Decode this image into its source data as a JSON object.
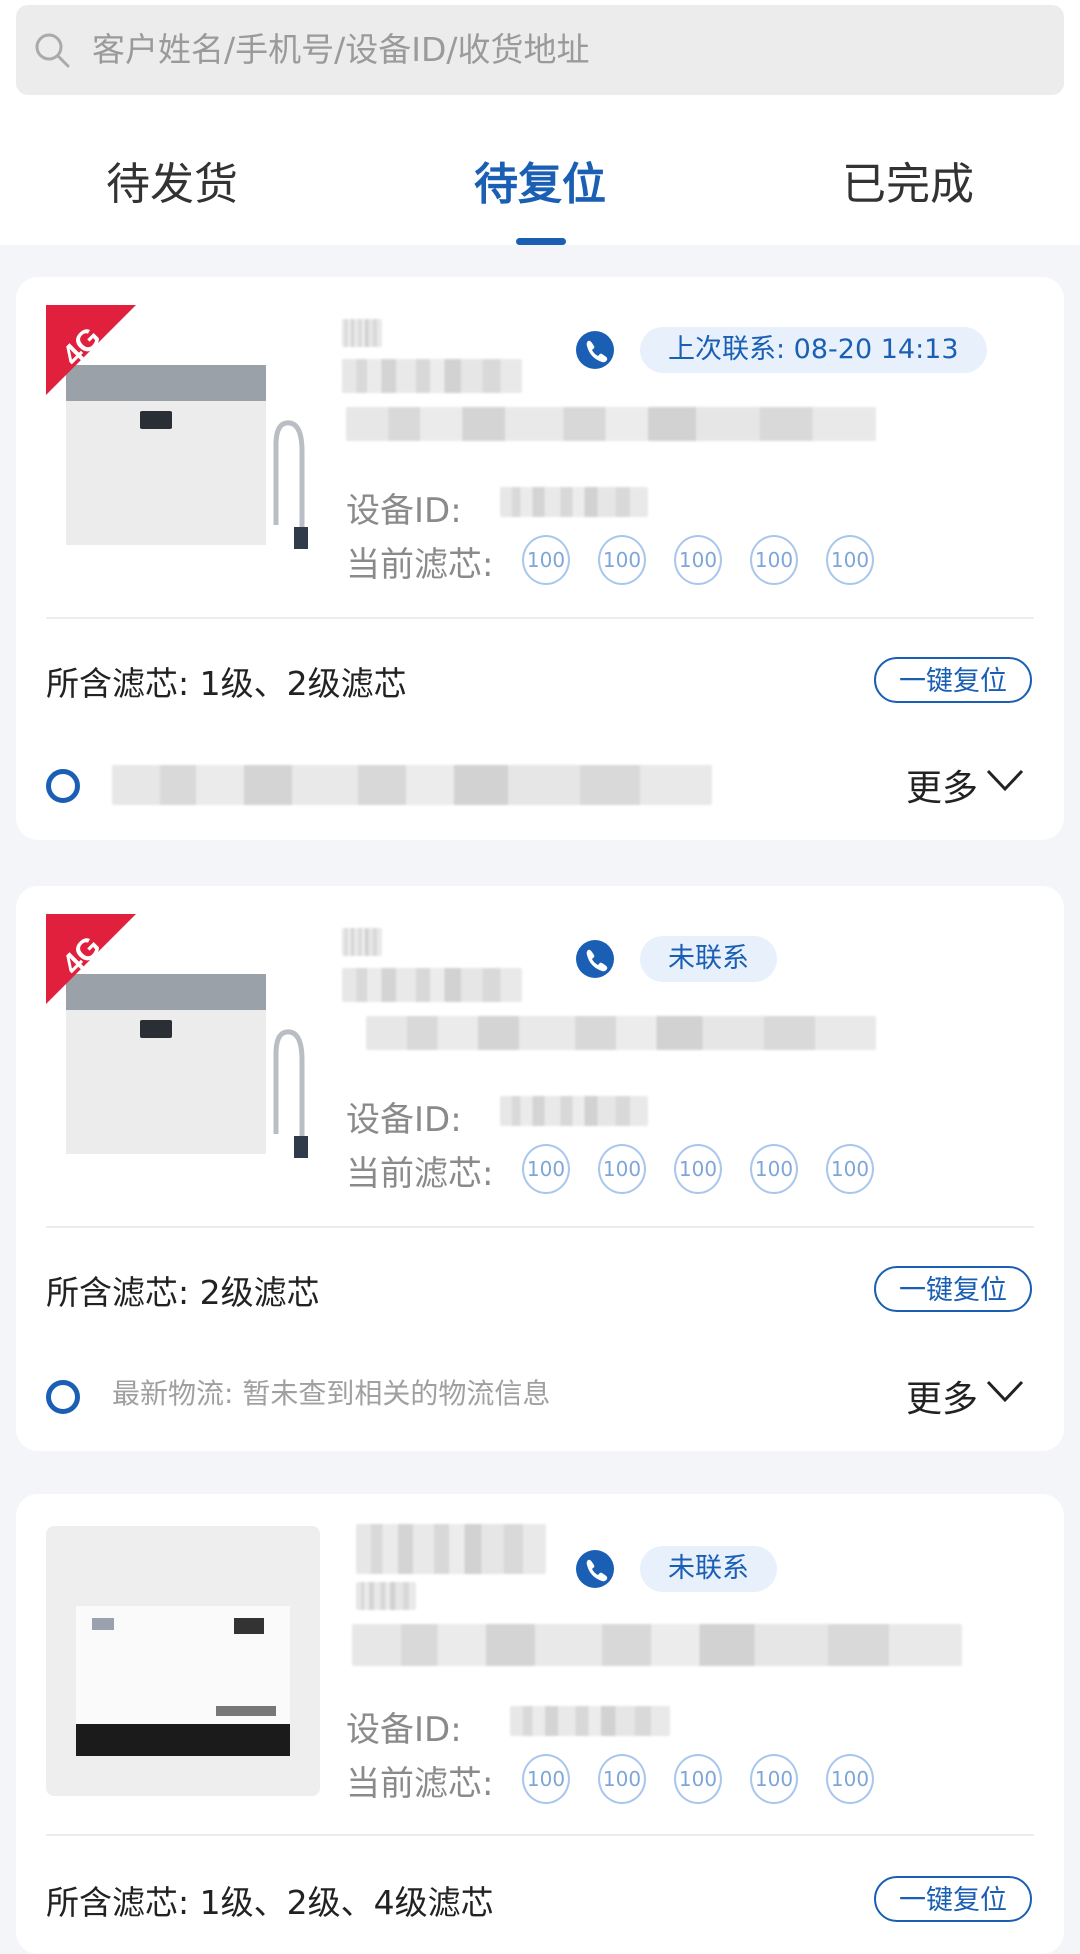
{
  "search": {
    "placeholder": "客户姓名/手机号/设备ID/收货地址"
  },
  "tabs": [
    {
      "label": "待发货",
      "active": false
    },
    {
      "label": "待复位",
      "active": true
    },
    {
      "label": "已完成",
      "active": false
    }
  ],
  "colors": {
    "accent": "#1a5fb4",
    "contact_bg": "#e8f1fb",
    "badge_red": "#e0203c"
  },
  "cards": [
    {
      "device_badge": "4G",
      "contact_status": "上次联系: 08-20 14:13",
      "device_id_label": "设备ID:",
      "current_filters_label": "当前滤芯:",
      "filter_levels": [
        "100",
        "100",
        "100",
        "100",
        "100"
      ],
      "included_filters": "所含滤芯:  1级、2级滤芯",
      "reset_label": "一键复位",
      "more_label": "更多"
    },
    {
      "device_badge": "4G",
      "contact_status": "未联系",
      "device_id_label": "设备ID:",
      "current_filters_label": "当前滤芯:",
      "filter_levels": [
        "100",
        "100",
        "100",
        "100",
        "100"
      ],
      "included_filters": "所含滤芯:  2级滤芯",
      "reset_label": "一键复位",
      "logistics": "最新物流: 暂未查到相关的物流信息",
      "more_label": "更多"
    },
    {
      "contact_status": "未联系",
      "device_id_label": "设备ID:",
      "current_filters_label": "当前滤芯:",
      "filter_levels": [
        "100",
        "100",
        "100",
        "100",
        "100"
      ],
      "included_filters": "所含滤芯:  1级、2级、4级滤芯",
      "reset_label": "一键复位"
    }
  ]
}
